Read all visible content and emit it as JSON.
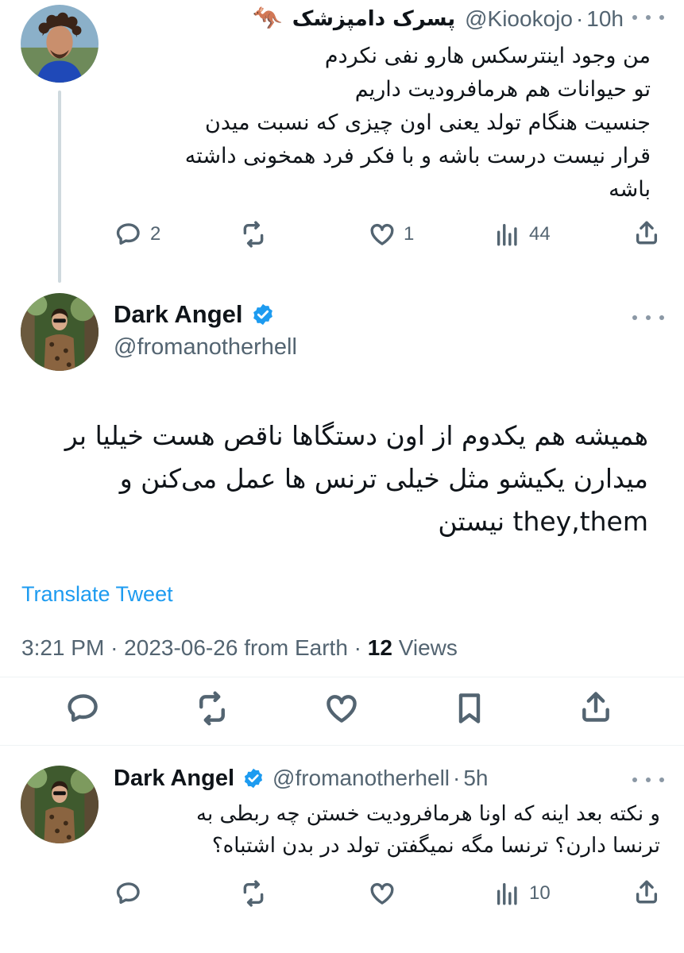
{
  "tweet1": {
    "display_name": "پسرک دامپزشک",
    "name_emoji": "🦘",
    "handle": "@Kiookojo",
    "separator": "·",
    "time": "10h",
    "text": "من وجود اینترسکس هارو نفی نکردم\nتو حیوانات هم هرمافرودیت داریم\nجنسیت هنگام تولد یعنی اون چیزی که نسبت میدن\nقرار نیست درست باشه و با فکر فرد همخونی داشته\nباشه",
    "replies": "2",
    "retweets": "",
    "likes": "1",
    "views": "44"
  },
  "main_tweet": {
    "display_name": "Dark Angel",
    "handle": "@fromanotherhell",
    "verified": true,
    "text": "همیشه هم یکدوم از اون دستگاها ناقص هست خیلیا بر\nمیدارن یکیشو مثل خیلی ترنس ها عمل می‌کنن و\nthey,them نیستن",
    "translate_label": "Translate Tweet",
    "time": "3:21 PM",
    "date": "2023-06-26",
    "source": "from Earth",
    "views_count": "12",
    "views_label": "Views"
  },
  "reply_tweet": {
    "display_name": "Dark Angel",
    "handle": "@fromanotherhell",
    "separator": "·",
    "time": "5h",
    "verified": true,
    "text": "و نکته بعد اینه که اونا هرمافرودیت خستن چه ربطی به\nترنسا دارن؟ ترنسا مگه نمیگفتن تولد در بدن اشتباه؟",
    "replies": "",
    "retweets": "",
    "likes": "",
    "views": "10"
  },
  "colors": {
    "text": "#0f1419",
    "secondary": "#536471",
    "accent": "#1d9bf0",
    "thread_line": "#cfd9de"
  },
  "icons": [
    "reply-icon",
    "retweet-icon",
    "like-icon",
    "views-icon",
    "share-icon",
    "bookmark-icon",
    "verified-icon",
    "more-icon"
  ]
}
